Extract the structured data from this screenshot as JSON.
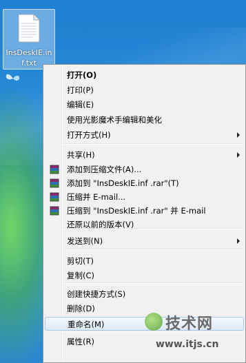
{
  "desktop": {
    "file": {
      "name": "InsDeskIE.inf.txt"
    }
  },
  "menu": {
    "items": [
      {
        "label": "打开(O)",
        "bold": true
      },
      {
        "label": "打印(P)"
      },
      {
        "label": "编辑(E)"
      },
      {
        "label": "使用光影魔术手编辑和美化"
      },
      {
        "label": "打开方式(H)",
        "submenu": true
      },
      {
        "label": "共享(H)",
        "submenu": true
      },
      {
        "label": "添加到压缩文件(A)...",
        "icon": "winrar-icon"
      },
      {
        "label": "添加到 \"InsDeskIE.inf .rar\"(T)",
        "icon": "winrar-icon"
      },
      {
        "label": "压缩并 E-mail...",
        "icon": "winrar-icon"
      },
      {
        "label": "压缩到 \"InsDeskIE.inf .rar\" 并 E-mail",
        "icon": "winrar-icon"
      },
      {
        "label": "还原以前的版本(V)"
      },
      {
        "label": "发送到(N)",
        "submenu": true
      },
      {
        "label": "剪切(T)"
      },
      {
        "label": "复制(C)"
      },
      {
        "label": "创建快捷方式(S)"
      },
      {
        "label": "删除(D)"
      },
      {
        "label": "重命名(M)",
        "highlighted": true
      },
      {
        "label": "属性(R)"
      }
    ]
  },
  "watermark": {
    "title": "技术网",
    "url": "www.itjs.cn"
  }
}
